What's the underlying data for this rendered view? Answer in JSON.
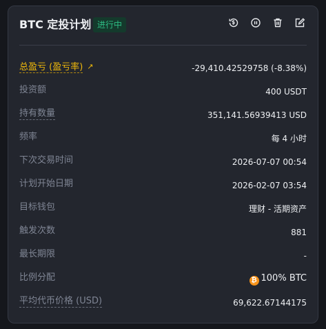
{
  "header": {
    "title": "BTC 定投计划",
    "status": "进行中",
    "icons": [
      "history-icon",
      "pause-icon",
      "delete-icon",
      "edit-icon"
    ]
  },
  "rows": [
    {
      "label": "总盈亏 (盈亏率)",
      "value": "-29,410.42529758 (-8.38%)"
    },
    {
      "label": "投资额",
      "value": "400 USDT"
    },
    {
      "label": "持有数量",
      "value": "351,141.56939413 USD"
    },
    {
      "label": "频率",
      "value": "每 4 小时"
    },
    {
      "label": "下次交易时间",
      "value": "2026-07-07 00:54"
    },
    {
      "label": "计划开始日期",
      "value": "2026-02-07 03:54"
    },
    {
      "label": "目标钱包",
      "value": "理财 - 活期资产"
    },
    {
      "label": "触发次数",
      "value": "881"
    },
    {
      "label": "最长期限",
      "value": "-"
    },
    {
      "label": "比例分配",
      "value": "100% BTC"
    },
    {
      "label": "平均代币价格 (USD)",
      "value": "69,622.67144175"
    }
  ],
  "colors": {
    "accent": "#f0b90b",
    "status_green": "#2ebd85",
    "card_bg": "#23262e",
    "btc_orange": "#f7931a"
  }
}
